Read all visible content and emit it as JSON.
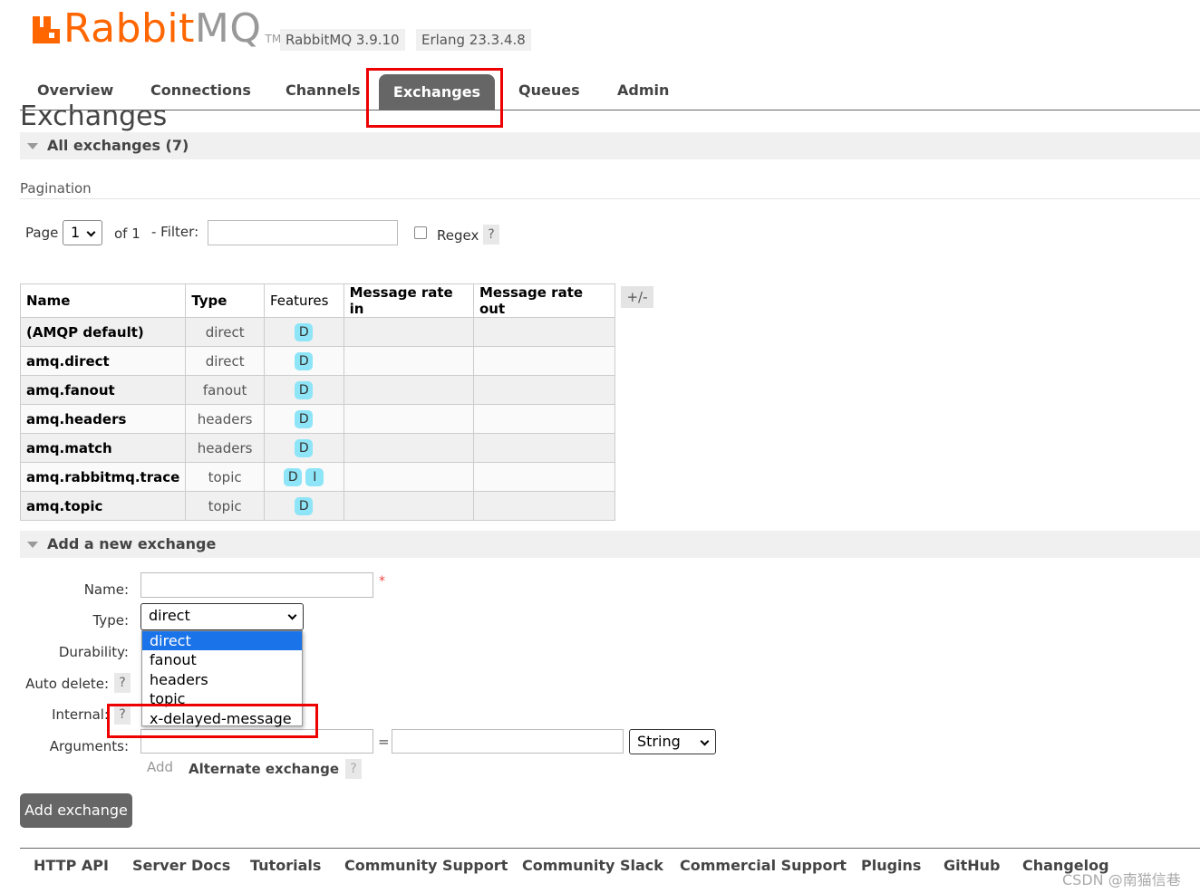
{
  "header": {
    "logo_rabbit": "Rabbit",
    "logo_mq": "MQ",
    "logo_tm": "TM",
    "rabbitmq_version": "RabbitMQ 3.9.10",
    "erlang_version": "Erlang 23.3.4.8",
    "brand_color": "#ff6600"
  },
  "nav": {
    "overview": "Overview",
    "connections": "Connections",
    "channels": "Channels",
    "exchanges": "Exchanges",
    "queues": "Queues",
    "admin": "Admin",
    "active": "Exchanges"
  },
  "page_title": "Exchanges",
  "all_exchanges": {
    "header": "All exchanges (7)",
    "pagination_label": "Pagination",
    "page_label": "Page",
    "page_value": "1",
    "of_label": "of 1",
    "filter_label": "- Filter:",
    "filter_value": "",
    "regex_label": "Regex",
    "regex_checked": false,
    "help": "?"
  },
  "table": {
    "columns": {
      "name": "Name",
      "type": "Type",
      "features": "Features",
      "rate_in": "Message rate in",
      "rate_out": "Message rate out"
    },
    "plus_minus": "+/-",
    "rows": [
      {
        "name": "(AMQP default)",
        "type": "direct",
        "features": [
          "D"
        ]
      },
      {
        "name": "amq.direct",
        "type": "direct",
        "features": [
          "D"
        ]
      },
      {
        "name": "amq.fanout",
        "type": "fanout",
        "features": [
          "D"
        ]
      },
      {
        "name": "amq.headers",
        "type": "headers",
        "features": [
          "D"
        ]
      },
      {
        "name": "amq.match",
        "type": "headers",
        "features": [
          "D"
        ]
      },
      {
        "name": "amq.rabbitmq.trace",
        "type": "topic",
        "features": [
          "D",
          "I"
        ]
      },
      {
        "name": "amq.topic",
        "type": "topic",
        "features": [
          "D"
        ]
      }
    ],
    "badge_color": "#8de5f7"
  },
  "add_exchange": {
    "header": "Add a new exchange",
    "name_label": "Name:",
    "name_value": "",
    "required_mark": "*",
    "type_label": "Type:",
    "type_value": "direct",
    "type_options": [
      "direct",
      "fanout",
      "headers",
      "topic",
      "x-delayed-message"
    ],
    "durability_label": "Durability:",
    "auto_delete_label": "Auto delete:",
    "internal_label": "Internal:",
    "arguments_label": "Arguments:",
    "arg_key": "",
    "equals": "=",
    "arg_value": "",
    "arg_type": "String",
    "add_link": "Add",
    "alternate_exchange": "Alternate exchange",
    "help": "?",
    "submit": "Add exchange"
  },
  "footer": {
    "links": [
      "HTTP API",
      "Server Docs",
      "Tutorials",
      "Community Support",
      "Community Slack",
      "Commercial Support",
      "Plugins",
      "GitHub",
      "Changelog"
    ],
    "watermark": "CSDN @南猫信巷"
  },
  "annotation_color": "#e00000"
}
